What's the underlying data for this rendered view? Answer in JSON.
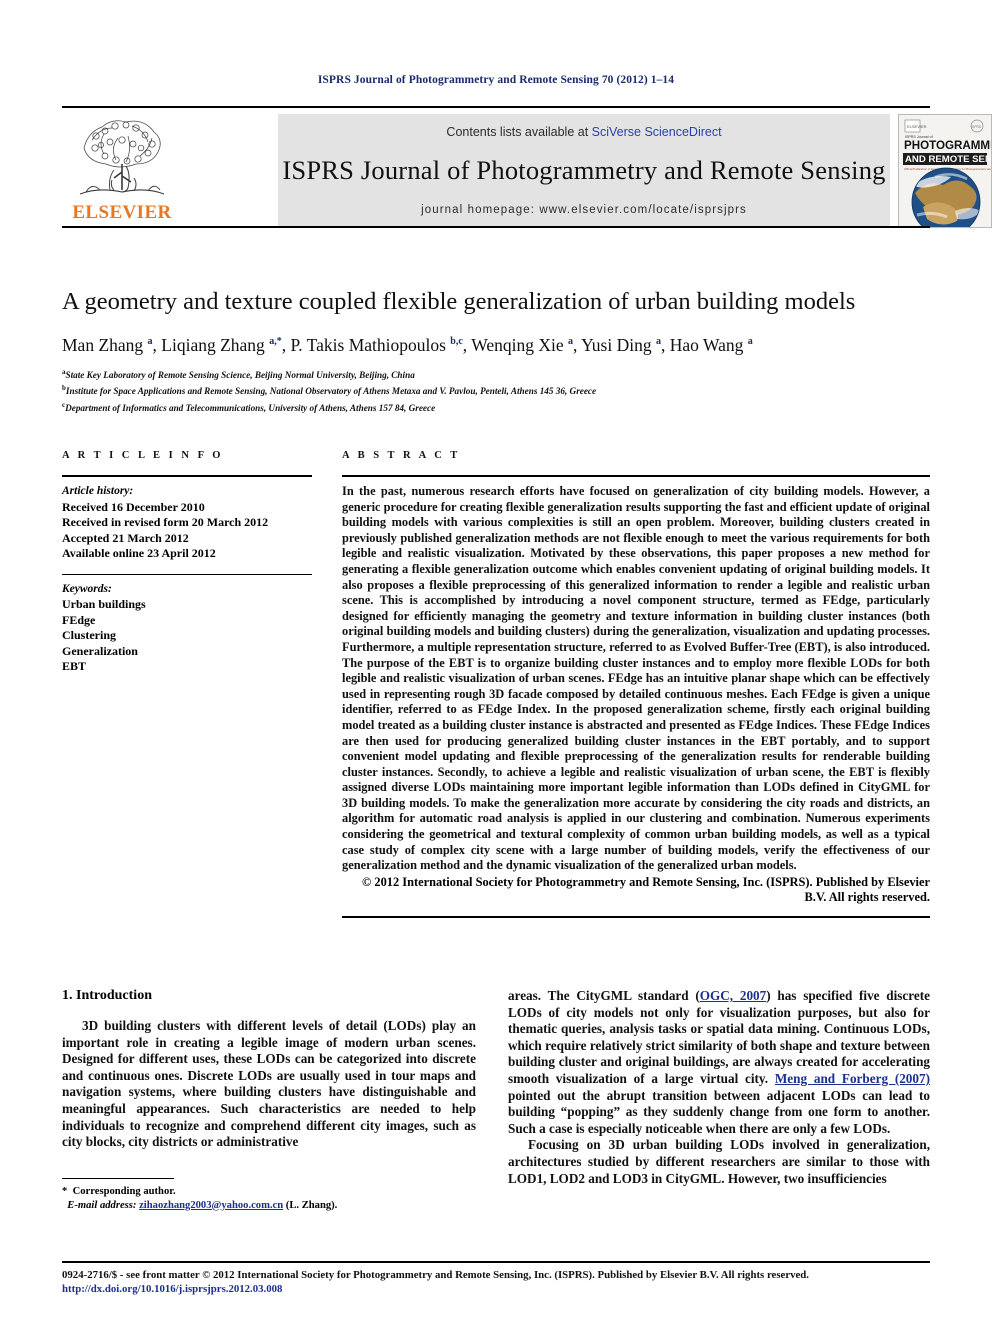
{
  "running_head": "ISPRS Journal of Photogrammetry and Remote Sensing 70 (2012) 1–14",
  "masthead": {
    "publisher_name": "ELSEVIER",
    "contents_prefix": "Contents lists available at ",
    "contents_link": "SciVerse ScienceDirect",
    "journal_name": "ISPRS Journal of Photogrammetry and Remote Sensing",
    "homepage_line": "journal homepage: www.elsevier.com/locate/isprsjprs",
    "cover": {
      "line1": "PHOTOGRAMMETRY",
      "line2": "AND REMOTE SENSING",
      "kicker": "ISPRS Journal of",
      "subtitle": "Official Publication of the International Society for Photogrammetry and Remote Sensing (ISPRS)"
    }
  },
  "article": {
    "title": "A geometry and texture coupled flexible generalization of urban building models",
    "authors_html": "Man Zhang <sup>a</sup>, Liqiang Zhang <sup>a,*</sup>, P. Takis Mathiopoulos <sup>b,c</sup>, Wenqing Xie <sup>a</sup>, Yusi Ding <sup>a</sup>, Hao Wang <sup>a</sup>",
    "affiliations": [
      "State Key Laboratory of Remote Sensing Science, Beijing Normal University, Beijing, China",
      "Institute for Space Applications and Remote Sensing, National Observatory of Athens Metaxa and V. Pavlou, Penteli, Athens 145 36, Greece",
      "Department of Informatics and Telecommunications, University of Athens, Athens 157 84, Greece"
    ],
    "affiliation_marks": [
      "a",
      "b",
      "c"
    ]
  },
  "article_info": {
    "heading": "A R T I C L E  I N F O",
    "history_label": "Article history:",
    "history": [
      "Received 16 December 2010",
      "Received in revised form 20 March 2012",
      "Accepted 21 March 2012",
      "Available online 23 April 2012"
    ],
    "keywords_label": "Keywords:",
    "keywords": [
      "Urban buildings",
      "FEdge",
      "Clustering",
      "Generalization",
      "EBT"
    ]
  },
  "abstract": {
    "heading": "A B S T R A C T",
    "text": "In the past, numerous research efforts have focused on generalization of city building models. However, a generic procedure for creating flexible generalization results supporting the fast and efficient update of original building models with various complexities is still an open problem. Moreover, building clusters created in previously published generalization methods are not flexible enough to meet the various requirements for both legible and realistic visualization. Motivated by these observations, this paper proposes a new method for generating a flexible generalization outcome which enables convenient updating of original building models. It also proposes a flexible preprocessing of this generalized information to render a legible and realistic urban scene. This is accomplished by introducing a novel component structure, termed as FEdge, particularly designed for efficiently managing the geometry and texture information in building cluster instances (both original building models and building clusters) during the generalization, visualization and updating processes. Furthermore, a multiple representation structure, referred to as Evolved Buffer-Tree (EBT), is also introduced. The purpose of the EBT is to organize building cluster instances and to employ more flexible LODs for both legible and realistic visualization of urban scenes. FEdge has an intuitive planar shape which can be effectively used in representing rough 3D facade composed by detailed continuous meshes. Each FEdge is given a unique identifier, referred to as FEdge Index. In the proposed generalization scheme, firstly each original building model treated as a building cluster instance is abstracted and presented as FEdge Indices. These FEdge Indices are then used for producing generalized building cluster instances in the EBT portably, and to support convenient model updating and flexible preprocessing of the generalization results for renderable building cluster instances. Secondly, to achieve a legible and realistic visualization of urban scene, the EBT is flexibly assigned diverse LODs maintaining more important legible information than LODs defined in CityGML for 3D building models. To make the generalization more accurate by considering the city roads and districts, an algorithm for automatic road analysis is applied in our clustering and combination. Numerous experiments considering the geometrical and textural complexity of common urban building models, as well as a typical case study of complex city scene with a large number of building models, verify the effectiveness of our generalization method and the dynamic visualization of the generalized urban models.",
    "copyright": "© 2012 International Society for Photogrammetry and Remote Sensing, Inc. (ISPRS). Published by Elsevier B.V. All rights reserved."
  },
  "introduction": {
    "heading": "1. Introduction",
    "left_paragraph": "3D building clusters with different levels of detail (LODs) play an important role in creating a legible image of modern urban scenes. Designed for different uses, these LODs can be categorized into discrete and continuous ones. Discrete LODs are usually used in tour maps and navigation systems, where building clusters have distinguishable and meaningful appearances. Such characteristics are needed to help individuals to recognize and comprehend different city images, such as city blocks, city districts or administrative",
    "right_paragraph_1_part1": "areas. The CityGML standard (",
    "right_paragraph_1_cite1": "OGC, 2007",
    "right_paragraph_1_part2": ") has specified five discrete LODs of city models not only for visualization purposes, but also for thematic queries, analysis tasks or spatial data mining. Continuous LODs, which require relatively strict similarity of both shape and texture between building cluster and original buildings, are always created for accelerating smooth visualization of a large virtual city. ",
    "right_paragraph_1_cite2": "Meng and Forberg (2007)",
    "right_paragraph_1_part3": " pointed out the abrupt transition between adjacent LODs can lead to building “popping” as they suddenly change from one form to another. Such a case is especially noticeable when there are only a few LODs.",
    "right_paragraph_2": "Focusing on 3D urban building LODs involved in generalization, architectures studied by different researchers are similar to those with LOD1, LOD2 and LOD3 in CityGML. However, two insufficiencies"
  },
  "footnote": {
    "corresponding_mark": "*",
    "corresponding_text": "Corresponding author.",
    "email_label": "E-mail address:",
    "email": "zihaozhang2003@yahoo.com.cn",
    "email_owner": "(L. Zhang)."
  },
  "page_footer": {
    "issn_line": "0924-2716/$ - see front matter © 2012 International Society for Photogrammetry and Remote Sensing, Inc. (ISPRS). Published by Elsevier B.V. All rights reserved.",
    "doi": "http://dx.doi.org/10.1016/j.isprsjprs.2012.03.008"
  },
  "colors": {
    "link": "#2b3fae",
    "cite": "#1b2f8f",
    "runhead": "#1a2a6c",
    "elsevier_orange": "#E87722",
    "band_gray": "#e3e3e3"
  }
}
